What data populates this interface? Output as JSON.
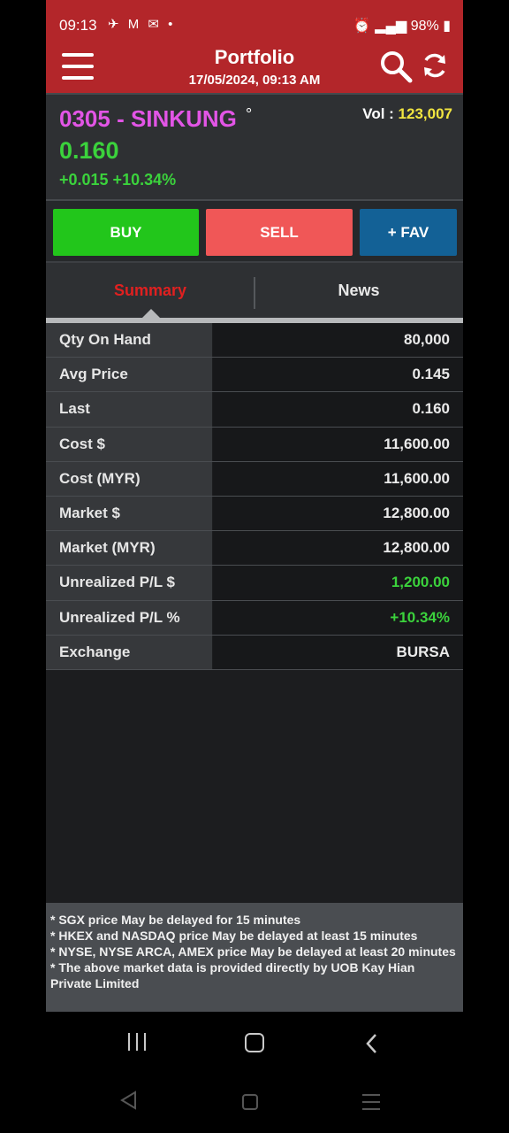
{
  "status_bar": {
    "time": "09:13",
    "left_icons": "✈ M ✉ •",
    "battery": "98%"
  },
  "header": {
    "title": "Portfolio",
    "datetime": "17/05/2024, 09:13 AM",
    "menu_icon": "hamburger-menu-icon",
    "search_icon": "search-icon",
    "refresh_icon": "refresh-icon",
    "color": "#b3262a"
  },
  "quote": {
    "name": "0305 - SINKUNG",
    "marker": "°",
    "vol_label": "Vol : ",
    "vol_value": "123,007",
    "price": "0.160",
    "change": "+0.015 +10.34%"
  },
  "actions": {
    "buy": "BUY",
    "sell": "SELL",
    "fav": "+ FAV"
  },
  "tabs": {
    "summary": "Summary",
    "news": "News",
    "active": "Summary"
  },
  "table": {
    "rows": [
      {
        "label": "Qty On Hand",
        "value": "80,000"
      },
      {
        "label": "Avg Price",
        "value": "0.145"
      },
      {
        "label": "Last",
        "value": "0.160"
      },
      {
        "label": "Cost $",
        "value": "11,600.00"
      },
      {
        "label": "Cost (MYR)",
        "value": "11,600.00"
      },
      {
        "label": "Market $",
        "value": "12,800.00"
      },
      {
        "label": "Market (MYR)",
        "value": "12,800.00"
      },
      {
        "label": "Unrealized P/L $",
        "value": "1,200.00"
      },
      {
        "label": "Unrealized P/L %",
        "value": "+10.34%"
      },
      {
        "label": "Exchange",
        "value": "BURSA"
      }
    ]
  },
  "disclaimer": {
    "lines": [
      "* SGX price May be delayed for 15 minutes",
      "* HKEX and NASDAQ price May be delayed at least 15 minutes",
      "* NYSE, NYSE ARCA, AMEX price May be delayed at least 20 minutes",
      "* The above market data is provided directly by UOB Kay Hian Private Limited"
    ]
  },
  "colors": {
    "positive": "#3bd23c",
    "stock_name": "#e255e6",
    "volume": "#f1e540",
    "buy": "#22c61b",
    "sell": "#f05757",
    "fav": "#136196",
    "active_tab": "#e02020"
  }
}
